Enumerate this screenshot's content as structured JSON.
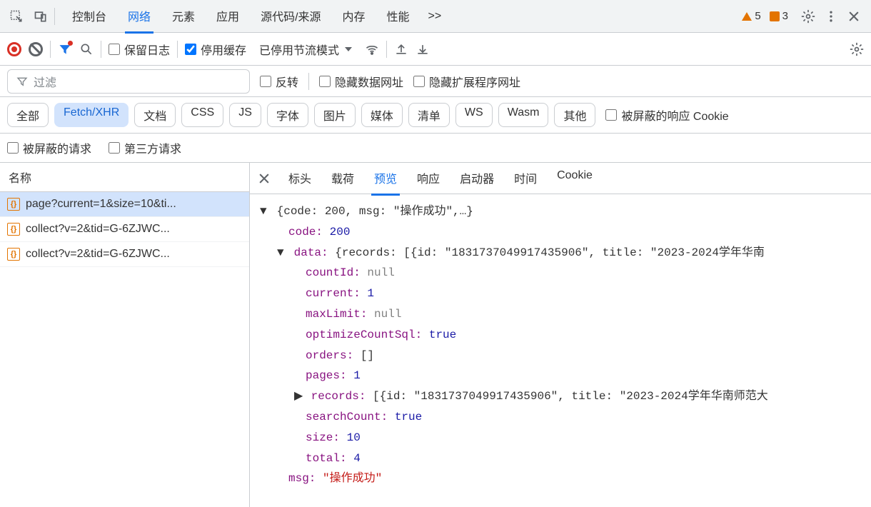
{
  "tabs": {
    "items": [
      "控制台",
      "网络",
      "元素",
      "应用",
      "源代码/来源",
      "内存",
      "性能"
    ],
    "active_index": 1,
    "overflow": ">>"
  },
  "warnings": {
    "triangle_count": 5,
    "square_count": 3
  },
  "toolbar": {
    "preserve_log": "保留日志",
    "preserve_log_checked": false,
    "disable_cache": "停用缓存",
    "disable_cache_checked": true,
    "throttling": "已停用节流模式"
  },
  "filter": {
    "placeholder": "过滤",
    "invert": "反转",
    "hide_data_urls": "隐藏数据网址",
    "hide_ext_urls": "隐藏扩展程序网址"
  },
  "chips": {
    "items": [
      "全部",
      "Fetch/XHR",
      "文档",
      "CSS",
      "JS",
      "字体",
      "图片",
      "媒体",
      "清单",
      "WS",
      "Wasm",
      "其他"
    ],
    "active_index": 1,
    "blocked_cookies": "被屏蔽的响应 Cookie"
  },
  "check_row": {
    "blocked_requests": "被屏蔽的请求",
    "third_party": "第三方请求"
  },
  "left": {
    "header": "名称",
    "items": [
      {
        "name": "page?current=1&size=10&ti...",
        "selected": true
      },
      {
        "name": "collect?v=2&tid=G-6ZJWC...",
        "selected": false
      },
      {
        "name": "collect?v=2&tid=G-6ZJWC...",
        "selected": false
      }
    ]
  },
  "detail_tabs": {
    "items": [
      "标头",
      "载荷",
      "预览",
      "响应",
      "启动器",
      "时间",
      "Cookie"
    ],
    "active_index": 2
  },
  "preview": {
    "top_line": "{code: 200, msg: \"操作成功\",…}",
    "code_key": "code:",
    "code_val": "200",
    "data_key": "data:",
    "data_summary": "{records: [{id: \"1831737049917435906\", title: \"2023-2024学年华南",
    "countId_key": "countId:",
    "countId_val": "null",
    "current_key": "current:",
    "current_val": "1",
    "maxLimit_key": "maxLimit:",
    "maxLimit_val": "null",
    "optimize_key": "optimizeCountSql:",
    "optimize_val": "true",
    "orders_key": "orders:",
    "orders_val": "[]",
    "pages_key": "pages:",
    "pages_val": "1",
    "records_key": "records:",
    "records_summary": "[{id: \"1831737049917435906\", title: \"2023-2024学年华南师范大",
    "searchCount_key": "searchCount:",
    "searchCount_val": "true",
    "size_key": "size:",
    "size_val": "10",
    "total_key": "total:",
    "total_val": "4",
    "msg_key": "msg:",
    "msg_val": "\"操作成功\""
  }
}
